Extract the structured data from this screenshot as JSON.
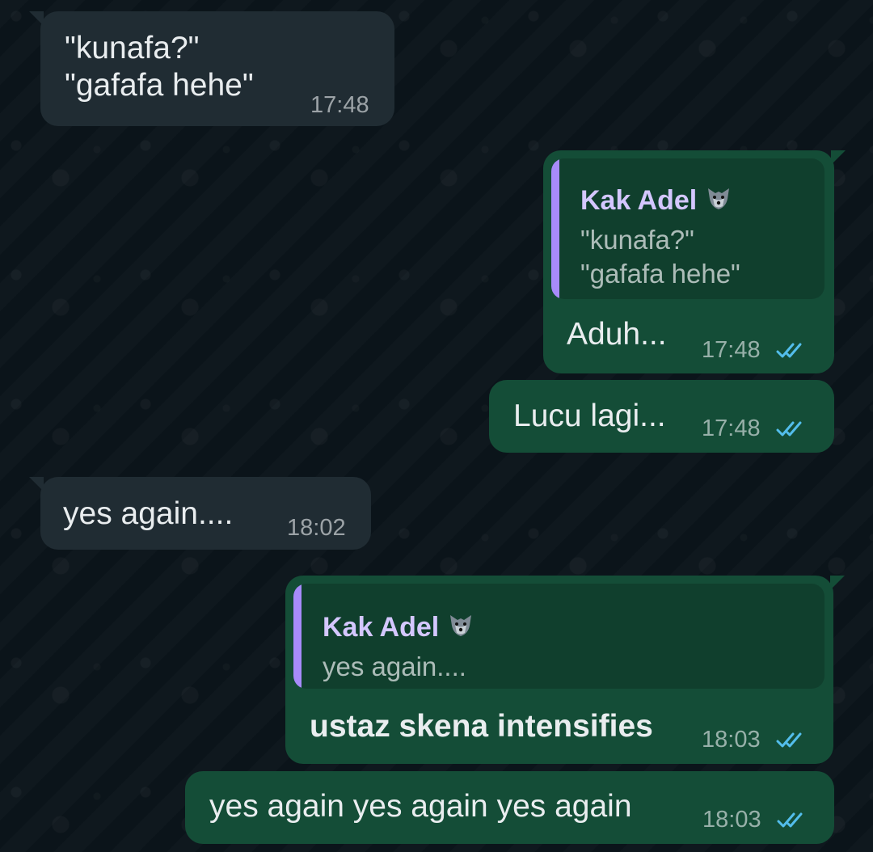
{
  "messages": [
    {
      "direction": "incoming",
      "text": "\"kunafa?\"\n\"gafafa hehe\"",
      "time": "17:48"
    },
    {
      "direction": "outgoing",
      "quote_author": "Kak Adel",
      "quote_author_emoji_icon": "wolf-emoji-icon",
      "quote_text": "\"kunafa?\"\n\"gafafa hehe\"",
      "text": "Aduh...",
      "time": "17:48",
      "status_icon": "double-check-icon"
    },
    {
      "direction": "outgoing",
      "text": "Lucu lagi...",
      "time": "17:48",
      "status_icon": "double-check-icon"
    },
    {
      "direction": "incoming",
      "text": "yes again....",
      "time": "18:02"
    },
    {
      "direction": "outgoing",
      "quote_author": "Kak Adel",
      "quote_author_emoji_icon": "wolf-emoji-icon",
      "quote_text": "yes again....",
      "text": "ustaz skena intensifies",
      "time": "18:03",
      "status_icon": "double-check-icon"
    },
    {
      "direction": "outgoing",
      "text": "yes again yes again yes again",
      "time": "18:03",
      "status_icon": "double-check-icon"
    }
  ],
  "colors": {
    "background": "#0b141a",
    "incoming_bubble": "#202c33",
    "outgoing_bubble": "#144d37",
    "quote_bar": "#a78bfa",
    "quote_author": "#d4c7ff",
    "read_ticks": "#53bdeb"
  }
}
